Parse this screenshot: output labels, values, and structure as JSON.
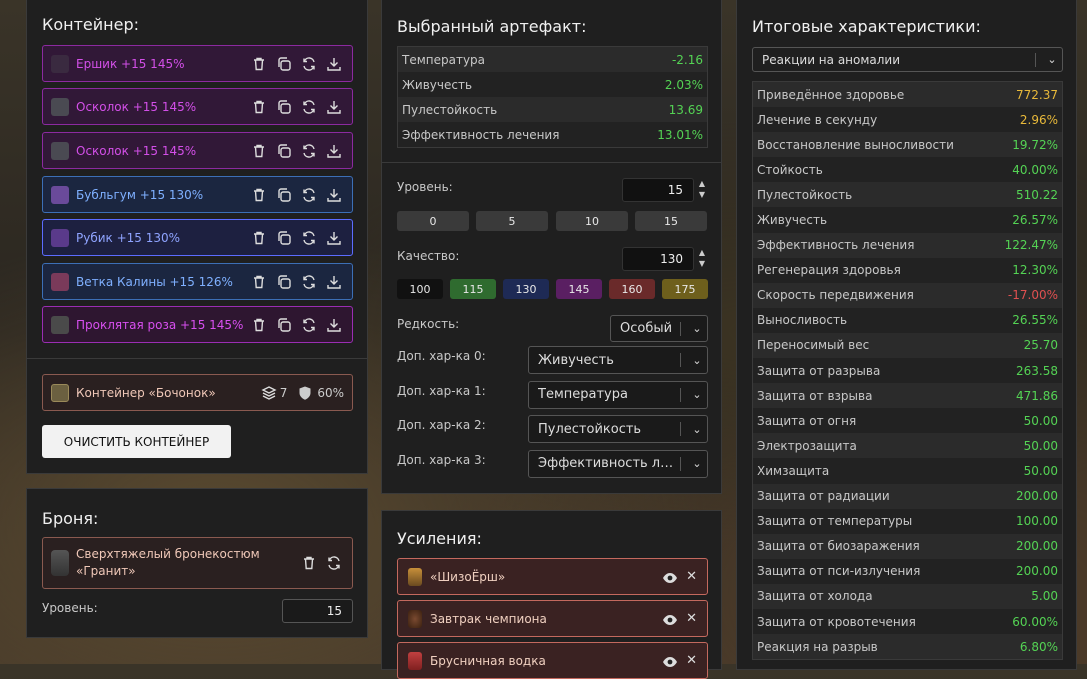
{
  "container": {
    "title": "Контейнер:",
    "items": [
      {
        "label": "Ершик +15 145%"
      },
      {
        "label": "Осколок +15 145%"
      },
      {
        "label": "Осколок +15 145%"
      },
      {
        "label": "Бубльгум +15 130%"
      },
      {
        "label": "Рубик +15 130%"
      },
      {
        "label": "Ветка Калины +15 126%"
      },
      {
        "label": "Проклятая роза +15 145%"
      }
    ],
    "box": {
      "label": "Контейнер «Бочонок»",
      "slots": "7",
      "protection": "60%"
    },
    "clear_button": "ОЧИСТИТЬ КОНТЕЙНЕР"
  },
  "armor": {
    "title": "Броня:",
    "name_line1": "Сверхтяжелый бронекостюм",
    "name_line2": "«Гранит»",
    "level_label": "Уровень:",
    "level_value": "15"
  },
  "artifact": {
    "title": "Выбранный артефакт:",
    "stats": [
      {
        "name": "Температура",
        "value": "-2.16"
      },
      {
        "name": "Живучесть",
        "value": "2.03%"
      },
      {
        "name": "Пулестойкость",
        "value": "13.69"
      },
      {
        "name": "Эффективность лечения",
        "value": "13.01%"
      }
    ],
    "level_label": "Уровень:",
    "level_value": "15",
    "level_presets": [
      "0",
      "5",
      "10",
      "15"
    ],
    "quality_label": "Качество:",
    "quality_value": "130",
    "quality_presets": [
      {
        "label": "100",
        "color": "#111111"
      },
      {
        "label": "115",
        "color": "#2f6b2f"
      },
      {
        "label": "130",
        "color": "#1e2a55"
      },
      {
        "label": "145",
        "color": "#5a1f62"
      },
      {
        "label": "160",
        "color": "#6a2a2a"
      },
      {
        "label": "175",
        "color": "#6e5f1c"
      }
    ],
    "rarity_label": "Редкость:",
    "rarity_value": "Особый",
    "extra": [
      {
        "label": "Доп. хар-ка 0:",
        "value": "Живучесть"
      },
      {
        "label": "Доп. хар-ка 1:",
        "value": "Температура"
      },
      {
        "label": "Доп. хар-ка 2:",
        "value": "Пулестойкость"
      },
      {
        "label": "Доп. хар-ка 3:",
        "value": "Эффективность ле..."
      }
    ]
  },
  "boosts": {
    "title": "Усиления:",
    "items": [
      {
        "label": "«ШизоЁрш»"
      },
      {
        "label": "Завтрак чемпиона"
      },
      {
        "label": "Брусничная водка"
      }
    ]
  },
  "totals": {
    "title": "Итоговые характеристики:",
    "filter": "Реакции на аномалии",
    "stats": [
      {
        "name": "Приведённое здоровье",
        "value": "772.37",
        "color": "#e8b93a"
      },
      {
        "name": "Лечение в секунду",
        "value": "2.96%",
        "color": "#e8b93a"
      },
      {
        "name": "Восстановление выносливости",
        "value": "19.72%",
        "color": "#54d354"
      },
      {
        "name": "Стойкость",
        "value": "40.00%",
        "color": "#54d354"
      },
      {
        "name": "Пулестойкость",
        "value": "510.22",
        "color": "#54d354"
      },
      {
        "name": "Живучесть",
        "value": "26.57%",
        "color": "#54d354"
      },
      {
        "name": "Эффективность лечения",
        "value": "122.47%",
        "color": "#54d354"
      },
      {
        "name": "Регенерация здоровья",
        "value": "12.30%",
        "color": "#54d354"
      },
      {
        "name": "Скорость передвижения",
        "value": "-17.00%",
        "color": "#e05050"
      },
      {
        "name": "Выносливость",
        "value": "26.55%",
        "color": "#54d354"
      },
      {
        "name": "Переносимый вес",
        "value": "25.70",
        "color": "#54d354"
      },
      {
        "name": "Защита от разрыва",
        "value": "263.58",
        "color": "#54d354"
      },
      {
        "name": "Защита от взрыва",
        "value": "471.86",
        "color": "#54d354"
      },
      {
        "name": "Защита от огня",
        "value": "50.00",
        "color": "#54d354"
      },
      {
        "name": "Электрозащита",
        "value": "50.00",
        "color": "#54d354"
      },
      {
        "name": "Химзащита",
        "value": "50.00",
        "color": "#54d354"
      },
      {
        "name": "Защита от радиации",
        "value": "200.00",
        "color": "#54d354"
      },
      {
        "name": "Защита от температуры",
        "value": "100.00",
        "color": "#54d354"
      },
      {
        "name": "Защита от биозаражения",
        "value": "200.00",
        "color": "#54d354"
      },
      {
        "name": "Защита от пси-излучения",
        "value": "200.00",
        "color": "#54d354"
      },
      {
        "name": "Защита от холода",
        "value": "5.00",
        "color": "#54d354"
      },
      {
        "name": "Защита от кровотечения",
        "value": "60.00%",
        "color": "#54d354"
      },
      {
        "name": "Реакция на разрыв",
        "value": "6.80%",
        "color": "#54d354"
      }
    ]
  }
}
